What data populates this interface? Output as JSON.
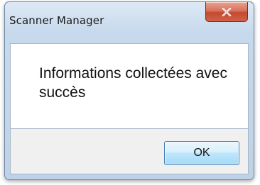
{
  "window": {
    "title": "Scanner Manager"
  },
  "dialog": {
    "message": "Informations collectées avec succès",
    "ok_label": "OK"
  },
  "icons": {
    "close": "close-icon"
  },
  "colors": {
    "close_button": "#c9503a",
    "ok_button_border": "#3c7fb1"
  }
}
